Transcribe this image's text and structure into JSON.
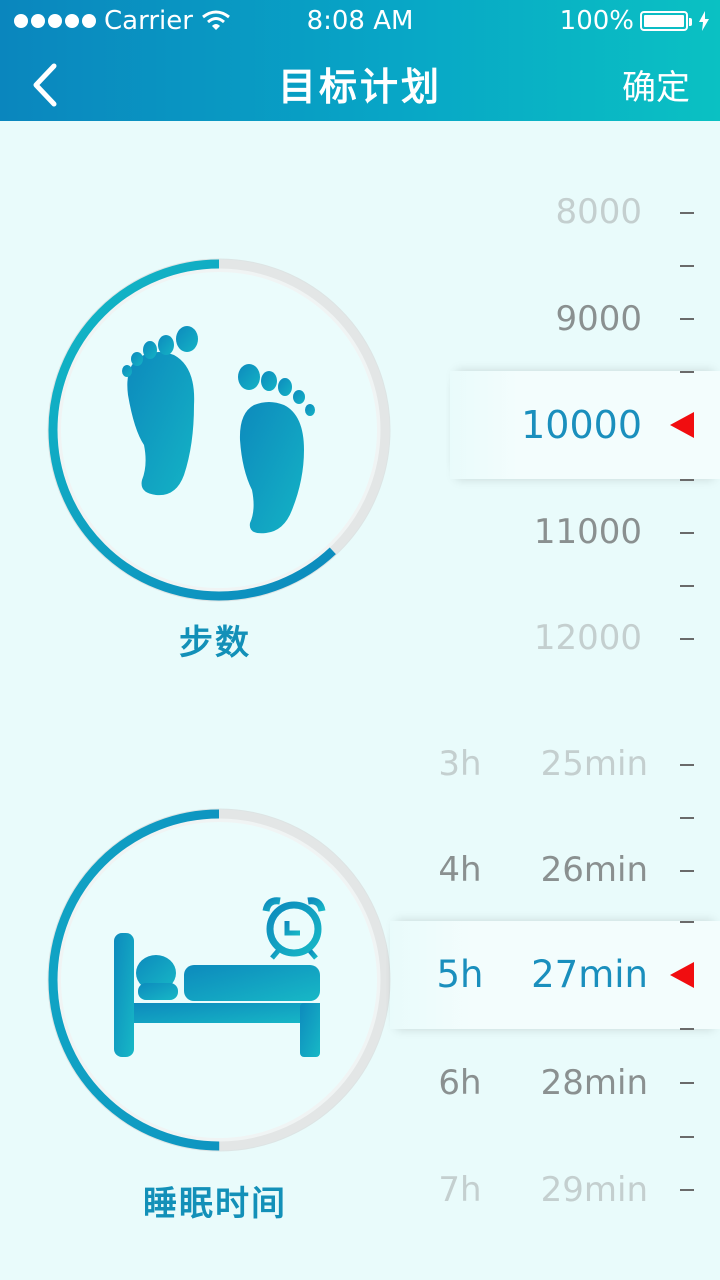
{
  "status_bar": {
    "carrier": "Carrier",
    "time": "8:08 AM",
    "battery_percent": "100%"
  },
  "nav": {
    "title": "目标计划",
    "confirm_label": "确定",
    "back_icon": "chevron-left-icon"
  },
  "steps": {
    "label": "步数",
    "icon": "footprints-icon",
    "progress": 0.62,
    "picker": {
      "options": [
        "8000",
        "9000",
        "10000",
        "11000",
        "12000"
      ],
      "selected": "10000"
    }
  },
  "sleep": {
    "label": "睡眠时间",
    "icon": "bed-alarm-icon",
    "progress": 0.5,
    "hours": [
      "3h",
      "4h",
      "5h",
      "6h",
      "7h"
    ],
    "minutes": [
      "25min",
      "26min",
      "27min",
      "28min",
      "29min"
    ],
    "selected_hours": "5h",
    "selected_minutes": "27min"
  },
  "colors": {
    "accent": "#1390b8",
    "selected_text": "#1a8fbd",
    "pointer": "#f10d10",
    "background": "#e9fbfb"
  }
}
